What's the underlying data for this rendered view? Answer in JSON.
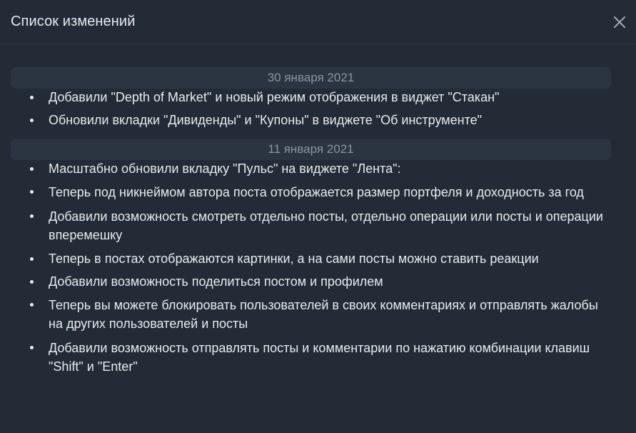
{
  "header": {
    "title": "Список изменений",
    "close_icon": "close-icon"
  },
  "sections": [
    {
      "date": "30 января 2021",
      "items": [
        "Добавили \"Depth of Market\" и новый режим отображения в виджет \"Стакан\"",
        "Обновили вкладки \"Дивиденды\" и \"Купоны\" в виджете \"Об инструменте\""
      ]
    },
    {
      "date": "11 января 2021",
      "items": [
        "Масштабно обновили вкладку \"Пульс\" на виджете \"Лента\":",
        "Теперь под никнеймом автора поста отображается размер портфеля и доходность за год",
        "Добавили возможность смотреть отдельно посты, отдельно операции или посты и операции вперемешку",
        "Теперь в постах отображаются картинки, а на сами посты можно ставить реакции",
        "Добавили возможность поделиться постом и профилем",
        "Теперь вы можете блокировать пользователей в своих комментариях и отправлять жалобы на других пользователей и посты",
        "Добавили возможность отправлять посты и комментарии по нажатию комбинации клавиш \"Shift\" и \"Enter\""
      ]
    }
  ],
  "colors": {
    "background": "#222b36",
    "date_bar": "#2b3541",
    "date_text": "#8a94a2",
    "text": "#e8ebf0"
  }
}
